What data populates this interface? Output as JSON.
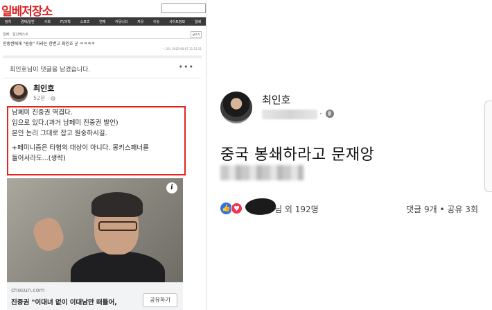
{
  "forum": {
    "logo_text": "일베저장소",
    "nav_items": [
      "정치",
      "경제/일반",
      "사회",
      "IT/과학",
      "스포츠",
      "연예",
      "커뮤니티",
      "자유",
      "이슈",
      "사이트정보",
      "일베"
    ],
    "breadcrumb": "일베 · 일간베스트",
    "write_label": "글쓰기",
    "post_title": "진중권에게 \"원숭\" 하라는 한변고 최인호 군 ㅋㅋㅋㅋ",
    "post_meta": "♡ 26  |  2020-08-07 11:15:51"
  },
  "fb_left": {
    "commented": "최인호님이 댓글을 남겼습니다.",
    "more": "•••",
    "name": "최인호",
    "time": "52분 · ",
    "body_lines": [
      "남페미 진중권 역겹다.",
      "입으로       있다.(과거 남페미 진중권 발언)",
      "본인 논리 그대로     잡고 원숭하시길.",
      "",
      "+페미니즘은 타협의 대상이 아니다. 몽키스패너를",
      "들어서라도...(생략)"
    ],
    "link_domain": "chosun.com",
    "link_title": "진중권 \"이대녀 없이 이대남만 떠들어,",
    "share_label": "공유하기"
  },
  "fb_right": {
    "name": "최인호",
    "time_separator": "·",
    "post_text": "중국 봉쇄하라고 문재앙",
    "reactors_text": "님 외 192명",
    "counts_text": "댓글 9개 • 공유 3회"
  },
  "colors": {
    "highlight_border": "#e0241f",
    "like_blue": "#2a73e8",
    "love_red": "#f0364e"
  }
}
